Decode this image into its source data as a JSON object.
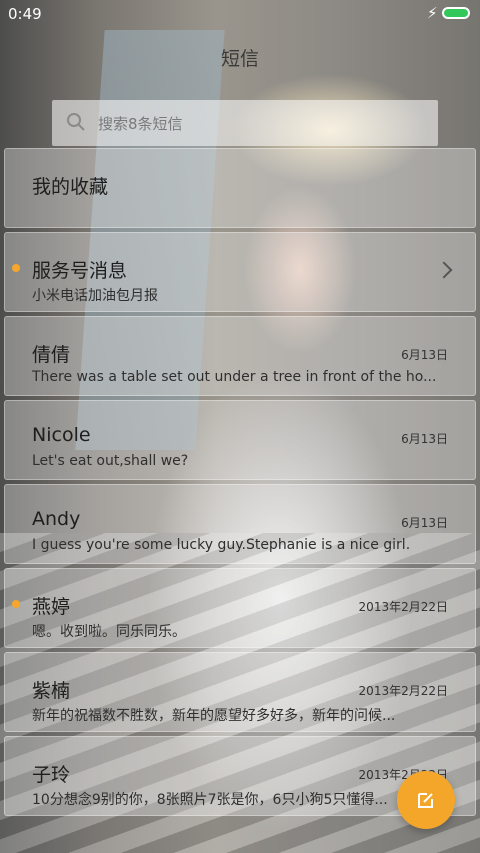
{
  "status": {
    "time": "0:49"
  },
  "header": {
    "title": "短信"
  },
  "search": {
    "placeholder": "搜索8条短信"
  },
  "list": [
    {
      "name": "我的收藏",
      "preview": "",
      "date": "",
      "unread": false,
      "chevron": false
    },
    {
      "name": "服务号消息",
      "preview": "小米电话加油包月报",
      "date": "",
      "unread": true,
      "chevron": true
    },
    {
      "name": "倩倩",
      "preview": "There was a table set out under a tree in front of the ho...",
      "date": "6月13日",
      "unread": false
    },
    {
      "name": "Nicole",
      "preview": "Let's eat out,shall we?",
      "date": "6月13日",
      "unread": false
    },
    {
      "name": "Andy",
      "preview": "I guess you're some lucky guy.Stephanie is a nice girl.",
      "date": "6月13日",
      "unread": false
    },
    {
      "name": "燕婷",
      "preview": "嗯。收到啦。同乐同乐。",
      "date": "2013年2月22日",
      "unread": true
    },
    {
      "name": "紫楠",
      "preview": "新年的祝福数不胜数，新年的愿望好多好多，新年的问候...",
      "date": "2013年2月22日",
      "unread": false
    },
    {
      "name": "子玲",
      "preview": "10分想念9别的你，8张照片7张是你，6只小狗5只懂得...",
      "date": "2013年2月22日",
      "unread": false
    }
  ],
  "colors": {
    "accent": "#f3a62a",
    "unread_dot": "#f6a62b"
  },
  "icons": {
    "search": "search-icon",
    "compose": "compose-icon",
    "battery": "battery-icon",
    "charging": "bolt-icon"
  }
}
